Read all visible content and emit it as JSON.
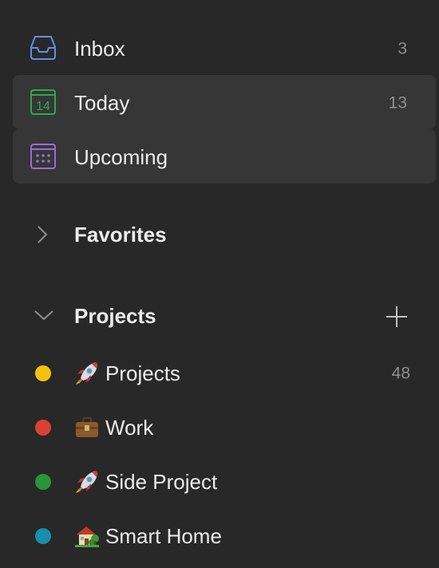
{
  "nav": {
    "inbox": {
      "label": "Inbox",
      "count": "3"
    },
    "today": {
      "label": "Today",
      "count": "13",
      "calendar_day": "14"
    },
    "upcoming": {
      "label": "Upcoming"
    }
  },
  "favorites": {
    "label": "Favorites"
  },
  "projects_section": {
    "label": "Projects",
    "items": [
      {
        "name": "Projects",
        "count": "48",
        "color": "#f4c20d",
        "emoji": "rocket"
      },
      {
        "name": "Work",
        "color": "#db4035",
        "emoji": "briefcase"
      },
      {
        "name": "Side Project",
        "color": "#299438",
        "emoji": "rocket"
      },
      {
        "name": "Smart Home",
        "color": "#158fad",
        "emoji": "house-with-garden"
      }
    ]
  },
  "colors": {
    "background": "#282828",
    "selected_background": "#363636",
    "inbox_icon": "#5f8fe8",
    "today_icon": "#2fa84f",
    "upcoming_icon": "#9b6bd9"
  }
}
